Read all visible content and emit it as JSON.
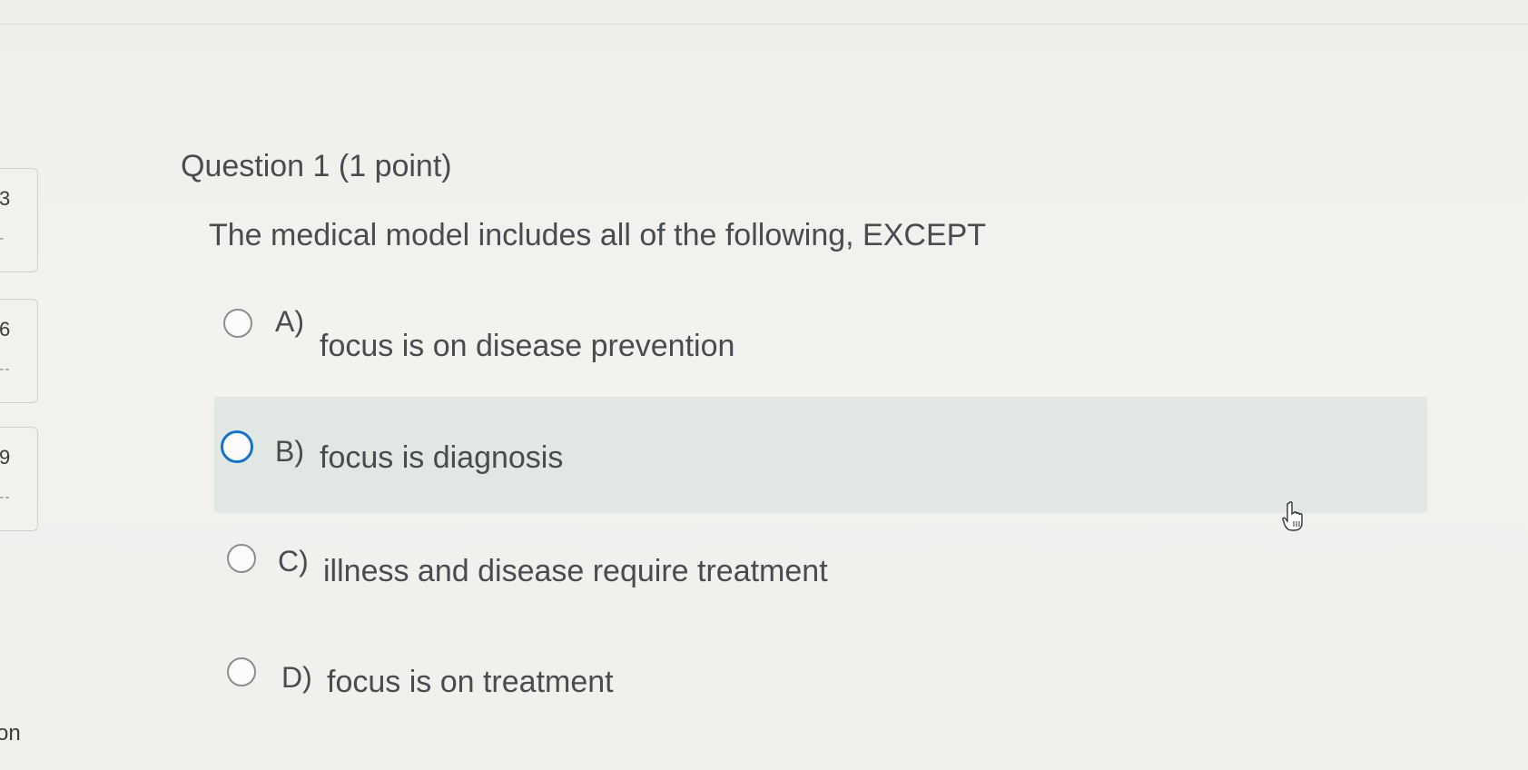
{
  "left_nav": {
    "items": [
      {
        "number": "3",
        "status": "-"
      },
      {
        "number": "6",
        "status": "--"
      },
      {
        "number": "9",
        "status": "--"
      }
    ],
    "partial_label": "on"
  },
  "question": {
    "title": "Question 1 (1 point)",
    "text": "The medical model includes all of the following, EXCEPT"
  },
  "options": [
    {
      "letter": "A)",
      "text": "focus is on disease prevention"
    },
    {
      "letter": "B)",
      "text": "focus is diagnosis"
    },
    {
      "letter": "C)",
      "text": "illness and disease require treatment"
    },
    {
      "letter": "D)",
      "text": "focus is on treatment"
    }
  ],
  "colors": {
    "hover_background": "#e1e8e4",
    "focus_ring": "#1572c8",
    "text": "#494c4e"
  },
  "cursor_icon": "hand-pointer-icon"
}
